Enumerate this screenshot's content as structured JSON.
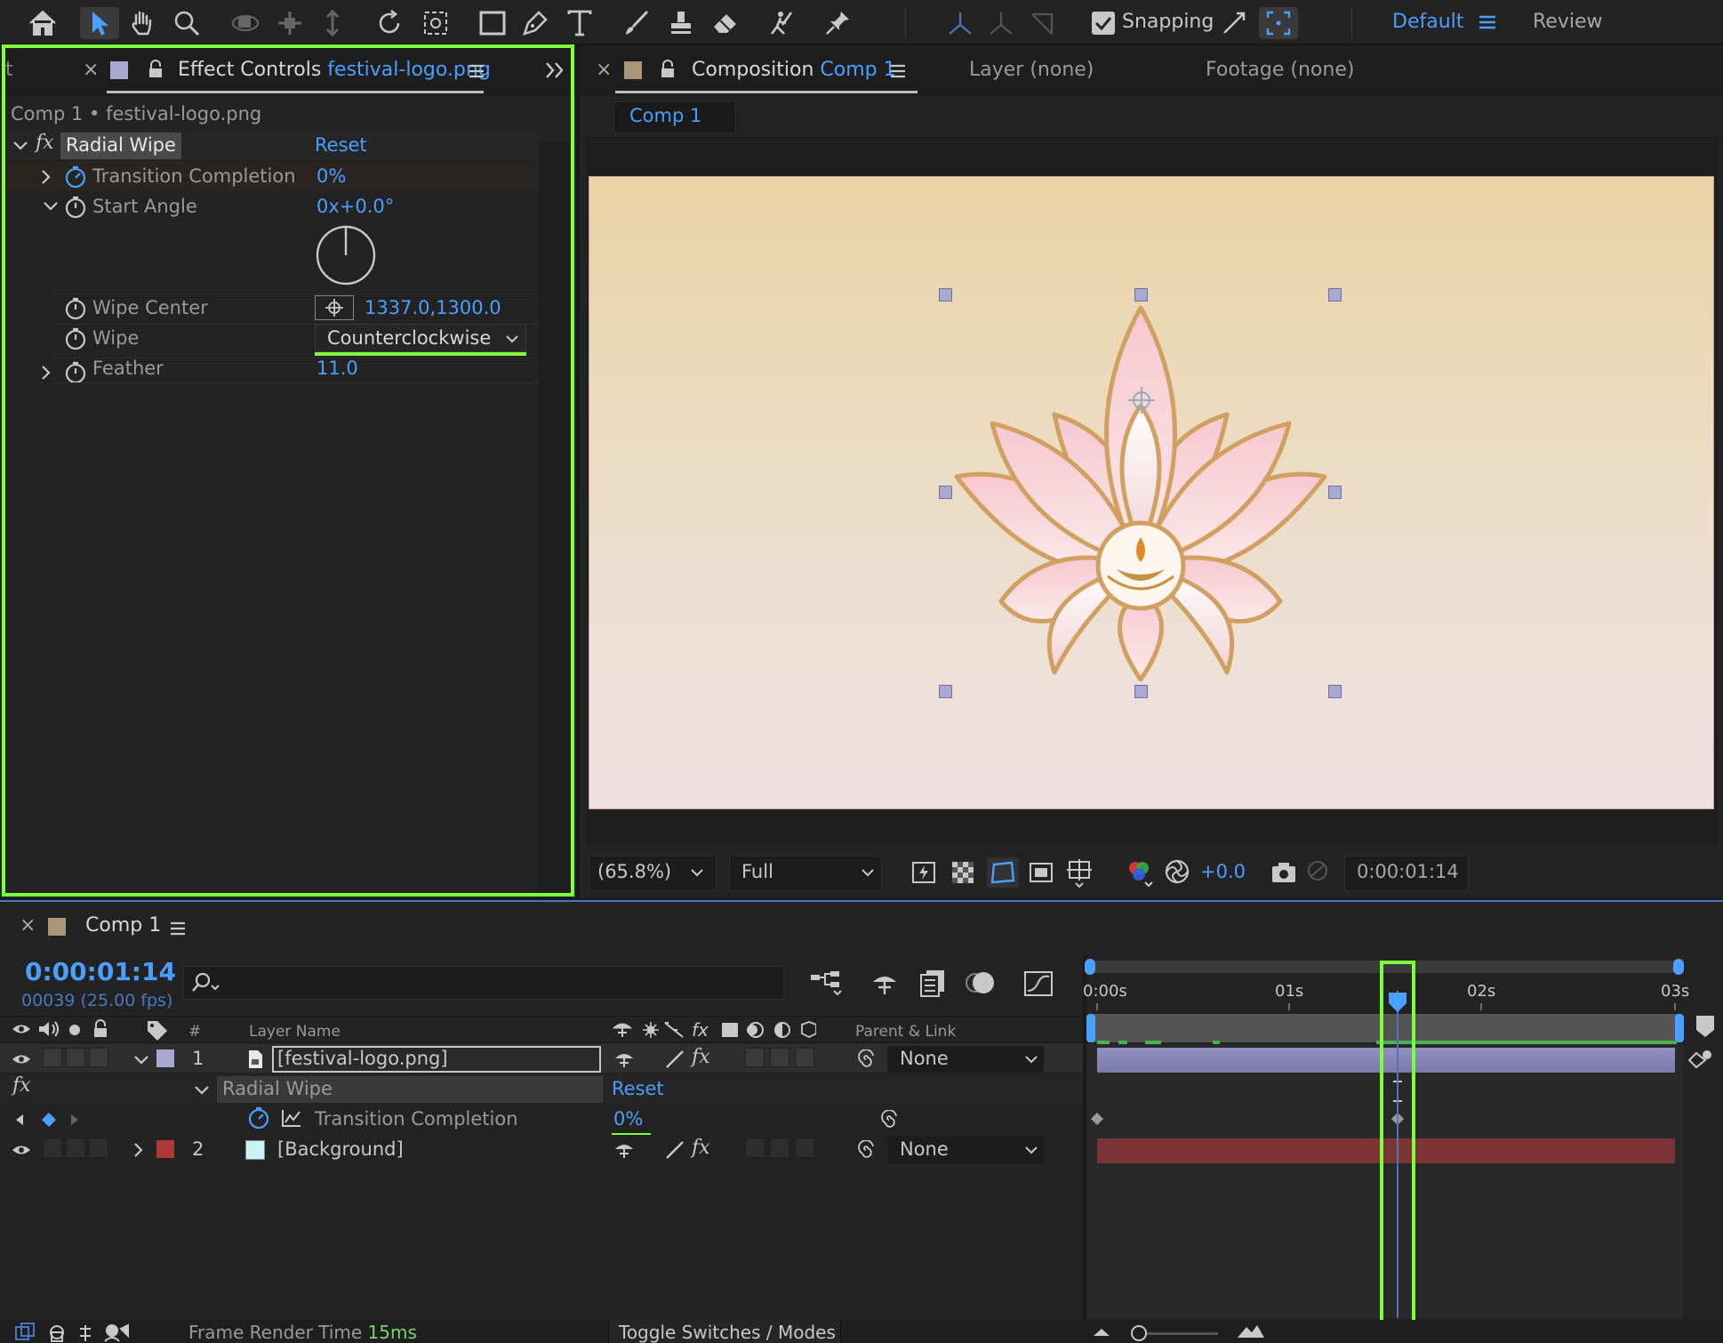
{
  "toolbar": {
    "snapping_label": "Snapping",
    "workspace_default": "Default",
    "workspace_review": "Review"
  },
  "effect_panel": {
    "title": "Effect Controls",
    "file": "festival-logo.png",
    "subtitle": "Comp 1 • festival-logo.png",
    "effect_name": "Radial Wipe",
    "reset": "Reset",
    "params": [
      {
        "label": "Transition Completion",
        "value": "0%"
      },
      {
        "label": "Start Angle",
        "value": "0x+0.0°"
      },
      {
        "label": "Wipe Center",
        "value": "1337.0,1300.0"
      },
      {
        "label": "Wipe",
        "value": "Counterclockwise"
      },
      {
        "label": "Feather",
        "value": "11.0"
      }
    ]
  },
  "comp_panel": {
    "title": "Composition",
    "comp_name": "Comp 1",
    "layer_tab": "Layer (none)",
    "footage_tab": "Footage (none)",
    "breadcrumb": "Comp 1",
    "zoom": "(65.8%)",
    "resolution": "Full",
    "exposure": "+0.0",
    "timecode": "0:00:01:14"
  },
  "timeline": {
    "tab": "Comp 1",
    "timecode": "0:00:01:14",
    "frame_info": "00039 (25.00 fps)",
    "search_placeholder": "",
    "col_hash": "#",
    "col_layer_name": "Layer Name",
    "col_parent": "Parent & Link",
    "ruler": [
      "0:00s",
      "01s",
      "02s",
      "03s"
    ],
    "layers": [
      {
        "num": "1",
        "name": "[festival-logo.png]",
        "parent": "None",
        "label_color": "#a8a8d0"
      },
      {
        "num": "2",
        "name": "[Background]",
        "parent": "None",
        "label_color": "#b03a3a"
      }
    ],
    "effect_row": {
      "name": "Radial Wipe",
      "reset": "Reset"
    },
    "property_row": {
      "name": "Transition Completion",
      "value": "0%"
    },
    "footer_label": "Frame Render Time",
    "footer_value": "15ms",
    "toggle_label": "Toggle Switches / Modes"
  },
  "colors": {
    "accent_blue": "#4a9fff",
    "highlight_green": "#7dff3c",
    "layer_bar": "#8a8ab8",
    "bg_bar": "#7a3434"
  }
}
